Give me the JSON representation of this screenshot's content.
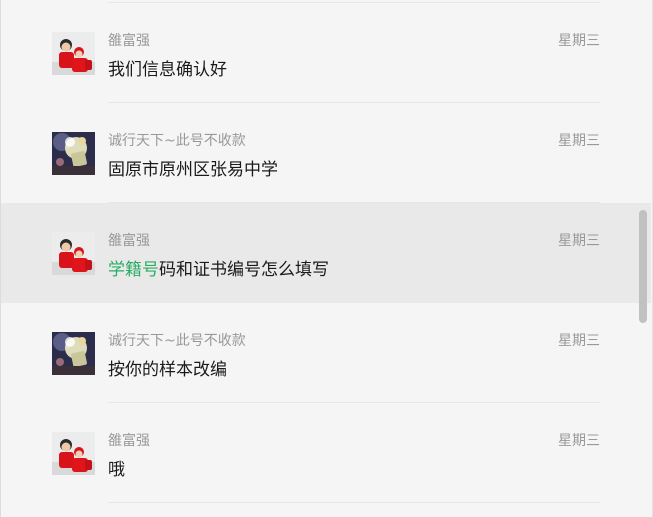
{
  "search_results": [
    {
      "name": "雒富强",
      "time": "星期三",
      "message_highlight": "",
      "message": "我们信息确认好",
      "avatar": "red-outfit-child-avatar",
      "active": false
    },
    {
      "name": "诚行天下~此号不收款",
      "time": "星期三",
      "message_highlight": "",
      "message": "固原市原州区张易中学",
      "avatar": "bouquet-avatar",
      "active": false
    },
    {
      "name": "雒富强",
      "time": "星期三",
      "message_highlight": "学籍号",
      "message": "码和证书编号怎么填写",
      "avatar": "red-outfit-child-avatar",
      "active": true
    },
    {
      "name": "诚行天下~此号不收款",
      "time": "星期三",
      "message_highlight": "",
      "message": "按你的样本改编",
      "avatar": "bouquet-avatar",
      "active": false
    },
    {
      "name": "雒富强",
      "time": "星期三",
      "message_highlight": "",
      "message": "哦",
      "avatar": "red-outfit-child-avatar",
      "active": false
    }
  ],
  "colors": {
    "highlight": "#2aae67",
    "active_row": "#e9e9e9",
    "background": "#f5f5f5"
  }
}
